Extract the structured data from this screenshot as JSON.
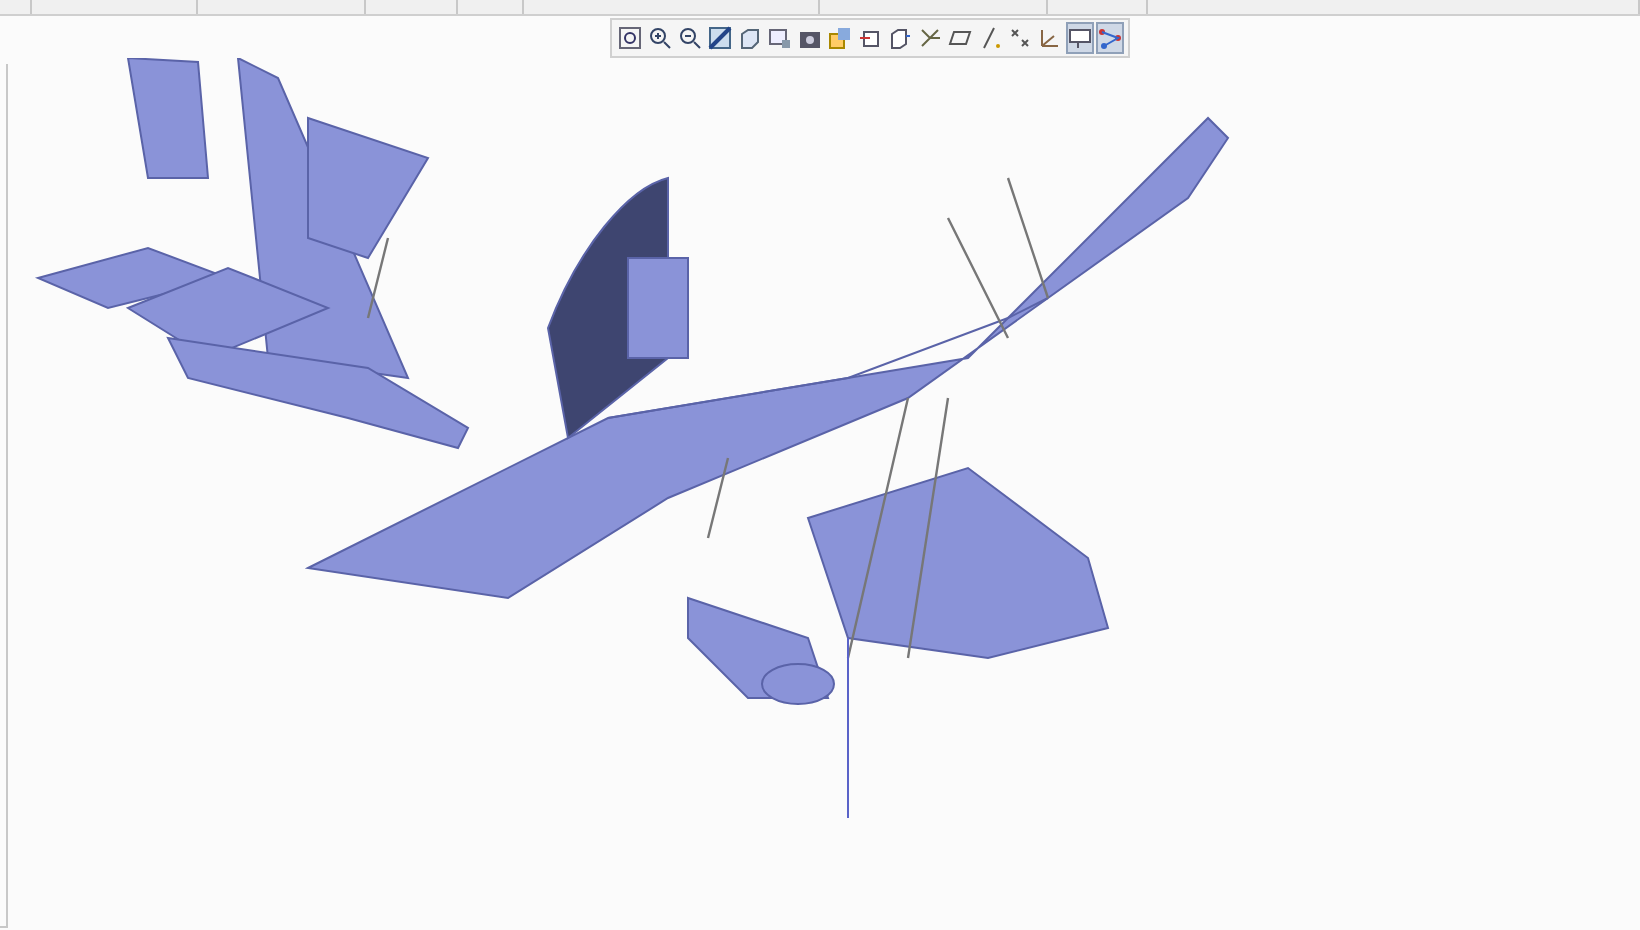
{
  "view_toolbar": {
    "buttons": [
      {
        "kind": "refit",
        "selected": false
      },
      {
        "kind": "zoom-in",
        "selected": false
      },
      {
        "kind": "zoom-out",
        "selected": false
      },
      {
        "kind": "repaint",
        "selected": false
      },
      {
        "kind": "display-style",
        "selected": false
      },
      {
        "kind": "saved-views",
        "selected": false
      },
      {
        "kind": "view-manager",
        "selected": false
      },
      {
        "kind": "perspective",
        "selected": false
      },
      {
        "kind": "section",
        "selected": false
      },
      {
        "kind": "spin-center",
        "selected": false
      },
      {
        "kind": "datum-display",
        "selected": false
      },
      {
        "kind": "plane",
        "selected": false
      },
      {
        "kind": "axis",
        "selected": false
      },
      {
        "kind": "point",
        "selected": false
      },
      {
        "kind": "csys",
        "selected": false
      },
      {
        "kind": "annotation",
        "selected": true
      },
      {
        "kind": "mechanism",
        "selected": true
      }
    ]
  }
}
